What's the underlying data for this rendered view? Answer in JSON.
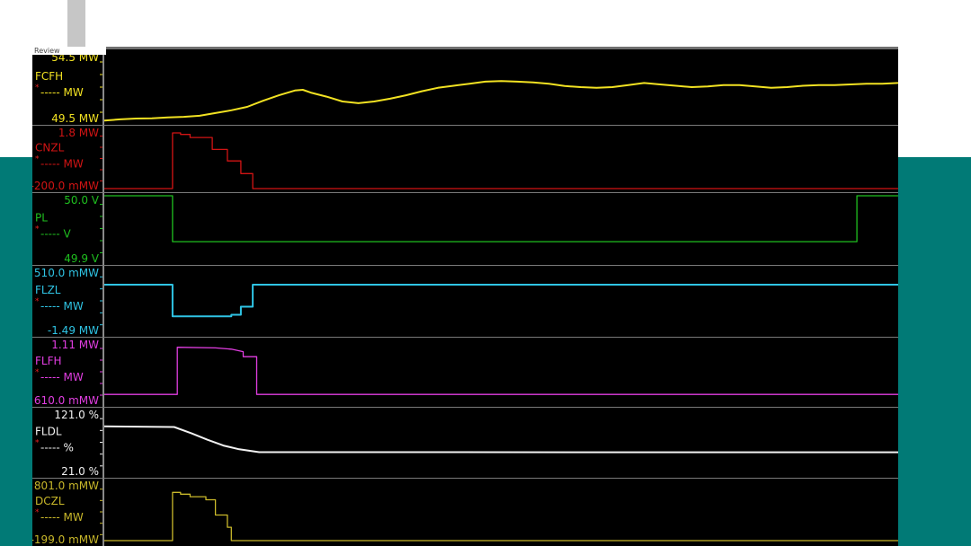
{
  "window": {
    "review_label": "Review"
  },
  "chart_data": {
    "type": "line",
    "x_domain": [
      0,
      1000
    ],
    "panels": [
      {
        "name": "FCFH",
        "color": "#f2e222",
        "top_label": "54.5  MW",
        "bottom_label": "49.5  MW",
        "unit_line": "----- MW",
        "ylim": [
          49.5,
          54.5
        ],
        "points": [
          [
            0,
            49.55
          ],
          [
            20,
            49.64
          ],
          [
            40,
            49.7
          ],
          [
            60,
            49.72
          ],
          [
            80,
            49.78
          ],
          [
            100,
            49.82
          ],
          [
            120,
            49.9
          ],
          [
            140,
            50.1
          ],
          [
            160,
            50.3
          ],
          [
            180,
            50.55
          ],
          [
            200,
            51.0
          ],
          [
            220,
            51.4
          ],
          [
            240,
            51.75
          ],
          [
            250,
            51.8
          ],
          [
            260,
            51.6
          ],
          [
            280,
            51.3
          ],
          [
            300,
            50.95
          ],
          [
            320,
            50.82
          ],
          [
            340,
            50.95
          ],
          [
            360,
            51.15
          ],
          [
            380,
            51.4
          ],
          [
            400,
            51.7
          ],
          [
            420,
            51.95
          ],
          [
            440,
            52.1
          ],
          [
            460,
            52.25
          ],
          [
            480,
            52.4
          ],
          [
            500,
            52.45
          ],
          [
            520,
            52.4
          ],
          [
            540,
            52.35
          ],
          [
            560,
            52.25
          ],
          [
            580,
            52.08
          ],
          [
            600,
            52.0
          ],
          [
            620,
            51.95
          ],
          [
            640,
            52.0
          ],
          [
            660,
            52.15
          ],
          [
            680,
            52.3
          ],
          [
            700,
            52.2
          ],
          [
            720,
            52.1
          ],
          [
            740,
            52.0
          ],
          [
            760,
            52.05
          ],
          [
            780,
            52.15
          ],
          [
            800,
            52.15
          ],
          [
            820,
            52.05
          ],
          [
            840,
            51.95
          ],
          [
            860,
            52.0
          ],
          [
            880,
            52.1
          ],
          [
            900,
            52.15
          ],
          [
            920,
            52.15
          ],
          [
            940,
            52.2
          ],
          [
            960,
            52.25
          ],
          [
            980,
            52.25
          ],
          [
            1000,
            52.3
          ]
        ]
      },
      {
        "name": "CNZL",
        "color": "#d21414",
        "top_label": "1.8  MW",
        "bottom_label": "-200.0 mMW",
        "unit_line": "----- MW",
        "ylim": [
          -0.2,
          1.8
        ],
        "points": [
          [
            0,
            -0.2
          ],
          [
            86,
            -0.2
          ],
          [
            86,
            1.65
          ],
          [
            96,
            1.65
          ],
          [
            96,
            1.6
          ],
          [
            108,
            1.6
          ],
          [
            108,
            1.5
          ],
          [
            136,
            1.5
          ],
          [
            136,
            1.1
          ],
          [
            155,
            1.1
          ],
          [
            155,
            0.72
          ],
          [
            172,
            0.72
          ],
          [
            172,
            0.3
          ],
          [
            187,
            0.3
          ],
          [
            187,
            -0.2
          ],
          [
            1000,
            -0.2
          ]
        ]
      },
      {
        "name": "PL",
        "color": "#1fc01f",
        "top_label": "50.0  V",
        "bottom_label": "49.9  V",
        "unit_line": "----- V",
        "ylim": [
          49.9,
          50.0
        ],
        "points": [
          [
            0,
            50.0
          ],
          [
            86,
            50.0
          ],
          [
            86,
            49.93
          ],
          [
            948,
            49.93
          ],
          [
            948,
            50.0
          ],
          [
            1000,
            50.0
          ]
        ]
      },
      {
        "name": "FLZL",
        "color": "#2fc4e4",
        "top_label": "510.0 mMW",
        "bottom_label": "-1.49  MW",
        "unit_line": "----- MW",
        "ylim": [
          -1.49,
          0.51
        ],
        "points": [
          [
            0,
            0.01
          ],
          [
            86,
            0.01
          ],
          [
            86,
            -0.97
          ],
          [
            160,
            -0.97
          ],
          [
            160,
            -0.92
          ],
          [
            172,
            -0.92
          ],
          [
            172,
            -0.67
          ],
          [
            187,
            -0.67
          ],
          [
            187,
            0.01
          ],
          [
            1000,
            0.01
          ]
        ]
      },
      {
        "name": "FLFH",
        "color": "#e23ee2",
        "top_label": "1.11  MW",
        "bottom_label": "610.0 mMW",
        "unit_line": "----- MW",
        "ylim": [
          0.61,
          1.11
        ],
        "points": [
          [
            0,
            0.68
          ],
          [
            92,
            0.68
          ],
          [
            92,
            1.055
          ],
          [
            140,
            1.05
          ],
          [
            160,
            1.04
          ],
          [
            175,
            1.02
          ],
          [
            175,
            0.98
          ],
          [
            192,
            0.98
          ],
          [
            192,
            0.68
          ],
          [
            1000,
            0.68
          ]
        ]
      },
      {
        "name": "FLDL",
        "color": "#f2f2f2",
        "top_label": "121.0  %",
        "bottom_label": "21.0  %",
        "unit_line": "----- %",
        "ylim": [
          21.0,
          121.0
        ],
        "points": [
          [
            0,
            96
          ],
          [
            88,
            95
          ],
          [
            110,
            85
          ],
          [
            130,
            75
          ],
          [
            150,
            66
          ],
          [
            170,
            60
          ],
          [
            195,
            55.5
          ],
          [
            300,
            55.5
          ],
          [
            600,
            55.3
          ],
          [
            1000,
            55.3
          ]
        ]
      },
      {
        "name": "DCZL",
        "color": "#c9b82a",
        "top_label": "801.0 mMW",
        "bottom_label": "-199.0 mMW",
        "unit_line": "----- MW",
        "ylim": [
          -0.199,
          0.801
        ],
        "points": [
          [
            0,
            -0.17
          ],
          [
            86,
            -0.17
          ],
          [
            86,
            0.62
          ],
          [
            96,
            0.62
          ],
          [
            96,
            0.59
          ],
          [
            108,
            0.59
          ],
          [
            108,
            0.55
          ],
          [
            128,
            0.55
          ],
          [
            128,
            0.5
          ],
          [
            140,
            0.5
          ],
          [
            140,
            0.25
          ],
          [
            155,
            0.25
          ],
          [
            155,
            0.05
          ],
          [
            160,
            0.05
          ],
          [
            160,
            -0.17
          ],
          [
            1000,
            -0.17
          ]
        ]
      }
    ]
  }
}
